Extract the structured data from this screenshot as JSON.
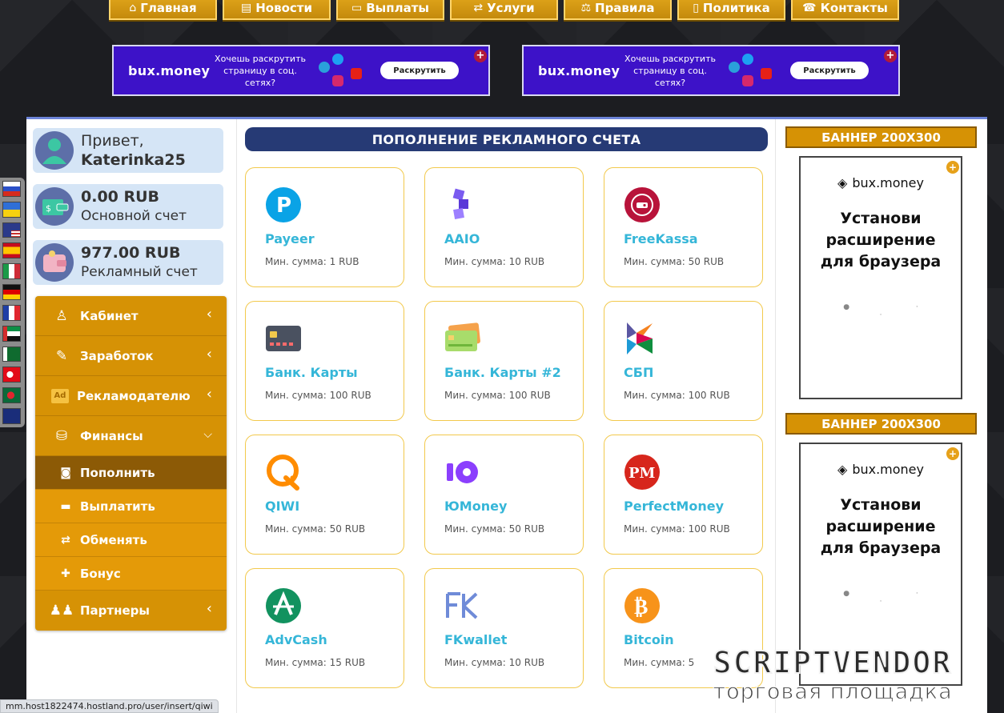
{
  "nav": [
    {
      "label": "Главная",
      "icon": "home-icon",
      "glyph": "⌂"
    },
    {
      "label": "Новости",
      "icon": "newspaper-icon",
      "glyph": "▤"
    },
    {
      "label": "Выплаты",
      "icon": "wallet-icon",
      "glyph": "▭"
    },
    {
      "label": "Услуги",
      "icon": "exchange-icon",
      "glyph": "⇄"
    },
    {
      "label": "Правила",
      "icon": "scales-icon",
      "glyph": "⚖"
    },
    {
      "label": "Политика",
      "icon": "document-icon",
      "glyph": "▯"
    },
    {
      "label": "Контакты",
      "icon": "headset-icon",
      "glyph": "☎"
    }
  ],
  "promo": {
    "brand": "bux.money",
    "text": "Хочешь раскрутить страницу в соц. сетях?",
    "cta": "Раскрутить",
    "plus": "+"
  },
  "user": {
    "greeting": "Привет,",
    "username": "Katerinka25"
  },
  "balances": [
    {
      "amount": "0.00 RUB",
      "label": "Основной счет"
    },
    {
      "amount": "977.00 RUB",
      "label": "Рекламный счет"
    }
  ],
  "menu": {
    "cabinet": "Кабинет",
    "earnings": "Заработок",
    "advertiser": "Рекламодателю",
    "finance": "Финансы",
    "topup": "Пополнить",
    "withdraw": "Выплатить",
    "exchange": "Обменять",
    "bonus": "Бонус",
    "partners": "Партнеры"
  },
  "section_title": "ПОПОЛНЕНИЕ РЕКЛАМНОГО СЧЕТА",
  "payment_methods": [
    {
      "name": "Payeer",
      "min": "Мин. сумма: 1 RUB"
    },
    {
      "name": "AAIO",
      "min": "Мин. сумма: 10 RUB"
    },
    {
      "name": "FreeKassa",
      "min": "Мин. сумма: 50 RUB"
    },
    {
      "name": "Банк. Карты",
      "min": "Мин. сумма: 100 RUB"
    },
    {
      "name": "Банк. Карты #2",
      "min": "Мин. сумма: 100 RUB"
    },
    {
      "name": "СБП",
      "min": "Мин. сумма: 100 RUB"
    },
    {
      "name": "QIWI",
      "min": "Мин. сумма: 50 RUB"
    },
    {
      "name": "ЮMoney",
      "min": "Мин. сумма: 50 RUB"
    },
    {
      "name": "PerfectMoney",
      "min": "Мин. сумма: 100 RUB"
    },
    {
      "name": "AdvCash",
      "min": "Мин. сумма: 15 RUB"
    },
    {
      "name": "FKwallet",
      "min": "Мин. сумма: 10 RUB"
    },
    {
      "name": "Bitcoin",
      "min": "Мин. сумма: 5"
    }
  ],
  "banner": {
    "title": "БАННЕР 200X300",
    "brand": "bux.money",
    "text_1": "Установи",
    "text_2": "расширение",
    "text_3": "для браузера",
    "dots": "● · ·",
    "plus": "+"
  },
  "status_url": "mm.host1822474.hostland.pro/user/insert/qiwi",
  "watermark": {
    "top": "SCRIPTVENDOR",
    "bottom": "торговая площадка"
  },
  "colors": {
    "gold": "#d69205",
    "navy": "#263a75",
    "cyan_text": "#35b6d8",
    "promo_bg": "#3d12c8"
  }
}
